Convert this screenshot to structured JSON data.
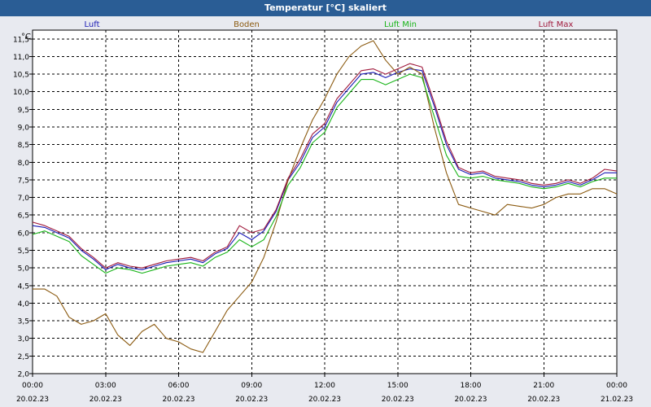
{
  "window": {
    "title": "Temperatur [°C] skaliert"
  },
  "chart_data": {
    "type": "line",
    "title": "Temperatur [°C] skaliert",
    "ylabel": "°C",
    "ylim": [
      2.0,
      11.75
    ],
    "y_ticks": [
      "2,0",
      "2,5",
      "3,0",
      "3,5",
      "4,0",
      "4,5",
      "5,0",
      "5,5",
      "6,0",
      "6,5",
      "7,0",
      "7,5",
      "8,0",
      "8,5",
      "9,0",
      "9,5",
      "10,0",
      "10,5",
      "11,0",
      "11,5"
    ],
    "xlim_hours": [
      0,
      24
    ],
    "x_ticks": [
      {
        "time": "00:00",
        "date": "20.02.23"
      },
      {
        "time": "03:00",
        "date": "20.02.23"
      },
      {
        "time": "06:00",
        "date": "20.02.23"
      },
      {
        "time": "09:00",
        "date": "20.02.23"
      },
      {
        "time": "12:00",
        "date": "20.02.23"
      },
      {
        "time": "15:00",
        "date": "20.02.23"
      },
      {
        "time": "18:00",
        "date": "20.02.23"
      },
      {
        "time": "21:00",
        "date": "20.02.23"
      },
      {
        "time": "00:00",
        "date": "21.02.23"
      }
    ],
    "grid": true,
    "legend_position": "top",
    "x_hours": [
      0,
      0.5,
      1,
      1.5,
      2,
      2.5,
      3,
      3.5,
      4,
      4.5,
      5,
      5.5,
      6,
      6.5,
      7,
      7.5,
      8,
      8.5,
      9,
      9.5,
      10,
      10.5,
      11,
      11.5,
      12,
      12.5,
      13,
      13.5,
      14,
      14.5,
      15,
      15.5,
      16,
      16.5,
      17,
      17.5,
      18,
      18.5,
      19,
      19.5,
      20,
      20.5,
      21,
      21.5,
      22,
      22.5,
      23,
      23.5,
      24
    ],
    "series": [
      {
        "name": "Luft",
        "color": "#1a1ab4",
        "values": [
          6.2,
          6.15,
          6.0,
          5.85,
          5.5,
          5.25,
          4.95,
          5.1,
          5.0,
          4.95,
          5.05,
          5.15,
          5.2,
          5.25,
          5.15,
          5.4,
          5.55,
          6.0,
          5.8,
          6.05,
          6.6,
          7.5,
          8.0,
          8.7,
          9.0,
          9.7,
          10.1,
          10.5,
          10.55,
          10.4,
          10.55,
          10.65,
          10.6,
          9.6,
          8.5,
          7.8,
          7.65,
          7.7,
          7.55,
          7.5,
          7.45,
          7.35,
          7.3,
          7.35,
          7.45,
          7.35,
          7.5,
          7.7,
          7.7
        ]
      },
      {
        "name": "Boden",
        "color": "#8b5a10",
        "values": [
          4.4,
          4.4,
          4.2,
          3.6,
          3.4,
          3.5,
          3.7,
          3.1,
          2.8,
          3.2,
          3.4,
          3.0,
          2.9,
          2.7,
          2.6,
          3.2,
          3.8,
          4.2,
          4.6,
          5.3,
          6.3,
          7.5,
          8.4,
          9.2,
          9.8,
          10.5,
          11.0,
          11.3,
          11.45,
          10.9,
          10.5,
          10.7,
          10.5,
          9.0,
          7.7,
          6.8,
          6.7,
          6.6,
          6.5,
          6.8,
          6.75,
          6.7,
          6.8,
          7.0,
          7.1,
          7.1,
          7.25,
          7.25,
          7.1
        ]
      },
      {
        "name": "Luft Min",
        "color": "#18b418",
        "values": [
          5.95,
          6.05,
          5.9,
          5.75,
          5.35,
          5.1,
          4.85,
          5.0,
          4.95,
          4.85,
          4.95,
          5.05,
          5.1,
          5.15,
          5.05,
          5.3,
          5.45,
          5.8,
          5.6,
          5.8,
          6.45,
          7.35,
          7.85,
          8.55,
          8.85,
          9.55,
          9.95,
          10.35,
          10.35,
          10.2,
          10.35,
          10.5,
          10.4,
          9.3,
          8.2,
          7.6,
          7.55,
          7.6,
          7.5,
          7.45,
          7.4,
          7.3,
          7.25,
          7.3,
          7.4,
          7.3,
          7.45,
          7.55,
          7.55
        ]
      },
      {
        "name": "Luft Max",
        "color": "#a01a3c",
        "values": [
          6.3,
          6.2,
          6.05,
          5.9,
          5.55,
          5.3,
          5.0,
          5.15,
          5.05,
          5.0,
          5.1,
          5.2,
          5.25,
          5.3,
          5.2,
          5.45,
          5.6,
          6.2,
          6.0,
          6.1,
          6.65,
          7.55,
          8.1,
          8.8,
          9.1,
          9.8,
          10.2,
          10.6,
          10.65,
          10.5,
          10.65,
          10.8,
          10.7,
          9.7,
          8.6,
          7.85,
          7.7,
          7.75,
          7.6,
          7.55,
          7.5,
          7.4,
          7.35,
          7.4,
          7.5,
          7.4,
          7.55,
          7.8,
          7.75
        ]
      }
    ]
  }
}
